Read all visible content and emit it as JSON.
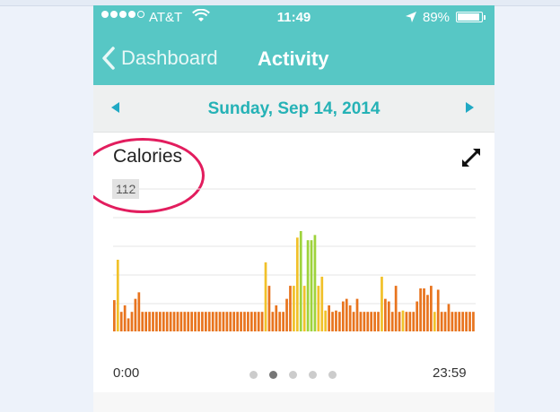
{
  "status_bar": {
    "carrier": "AT&T",
    "time": "11:49",
    "battery": "89%",
    "signal_bars": 4,
    "icons": [
      "wifi-icon",
      "location-arrow-icon",
      "battery-icon"
    ]
  },
  "nav": {
    "back_label": "Dashboard",
    "title": "Activity"
  },
  "date_bar": {
    "date": "Sunday, Sep 14, 2014"
  },
  "card": {
    "title": "Calories",
    "selected_value": "112",
    "x_start": "0:00",
    "x_end": "23:59",
    "pages": 5,
    "active_page": 1
  },
  "colors": {
    "teal": "#57c7c5",
    "date_text": "#25b2b6",
    "bar_orange": "#e8741e",
    "bar_yellow": "#f1c12a",
    "bar_green": "#9ed33c",
    "annotation": "#e21d5e"
  },
  "chart_data": {
    "type": "bar",
    "y_max": 11,
    "values": [
      2.4,
      5.5,
      1.5,
      2.0,
      1.0,
      1.5,
      2.5,
      3.0,
      1.5,
      1.5,
      1.5,
      1.5,
      1.5,
      1.5,
      1.5,
      1.5,
      1.5,
      1.5,
      1.5,
      1.5,
      1.5,
      1.5,
      1.5,
      1.5,
      1.5,
      1.5,
      1.5,
      1.5,
      1.5,
      1.5,
      1.5,
      1.5,
      1.5,
      1.5,
      1.5,
      1.5,
      1.5,
      1.5,
      1.5,
      1.5,
      1.5,
      1.5,
      1.5,
      5.3,
      3.5,
      1.5,
      2.0,
      1.5,
      1.5,
      2.5,
      3.5,
      3.5,
      7.2,
      7.7,
      3.5,
      7.0,
      7.0,
      7.4,
      3.5,
      4.2,
      1.6,
      2.0,
      1.5,
      1.6,
      1.5,
      2.3,
      2.5,
      2.0,
      1.5,
      2.5,
      1.5,
      1.5,
      1.5,
      1.5,
      1.5,
      1.5,
      4.2,
      2.5,
      2.3,
      1.5,
      3.5,
      1.5,
      1.6,
      1.5,
      1.5,
      1.5,
      2.3,
      3.3,
      3.3,
      2.8,
      3.5,
      1.5,
      3.2,
      1.5,
      1.5,
      2.1,
      1.5,
      1.5,
      1.5,
      1.5,
      1.5,
      1.5,
      1.5
    ],
    "colors": [
      "o",
      "y",
      "o",
      "o",
      "o",
      "o",
      "o",
      "o",
      "o",
      "o",
      "o",
      "o",
      "o",
      "o",
      "o",
      "o",
      "o",
      "o",
      "o",
      "o",
      "o",
      "o",
      "o",
      "o",
      "o",
      "o",
      "o",
      "o",
      "o",
      "o",
      "o",
      "o",
      "o",
      "o",
      "o",
      "o",
      "o",
      "o",
      "o",
      "o",
      "o",
      "o",
      "o",
      "y",
      "o",
      "o",
      "o",
      "o",
      "o",
      "o",
      "o",
      "y",
      "y",
      "g",
      "y",
      "g",
      "g",
      "g",
      "y",
      "y",
      "y",
      "o",
      "o",
      "o",
      "o",
      "o",
      "o",
      "o",
      "o",
      "o",
      "o",
      "o",
      "o",
      "o",
      "o",
      "o",
      "y",
      "o",
      "o",
      "o",
      "o",
      "o",
      "y",
      "o",
      "o",
      "o",
      "o",
      "o",
      "o",
      "o",
      "o",
      "y",
      "o",
      "o",
      "o",
      "o",
      "o",
      "o",
      "o",
      "o",
      "o",
      "o",
      "o",
      "o",
      "o"
    ]
  }
}
